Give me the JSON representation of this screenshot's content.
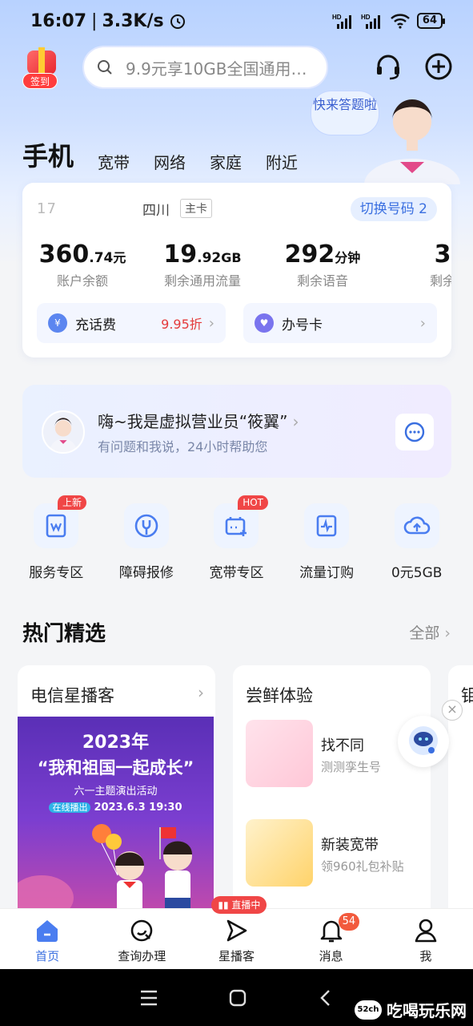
{
  "status_bar": {
    "time": "16:07",
    "speed": "3.3K/s",
    "battery": "64"
  },
  "header": {
    "signin_label": "签到",
    "search_placeholder": "9.9元享10GB全国通用…",
    "bubble_text": "快来答题啦"
  },
  "tabs": [
    "手机",
    "宽带",
    "网络",
    "家庭",
    "附近"
  ],
  "account": {
    "number": "17",
    "region": "四川",
    "card_type": "主卡",
    "switch_label": "切换号码 2",
    "stats": [
      {
        "value_int": "360",
        "value_dec": ".74",
        "unit": "元",
        "label": "账户余额"
      },
      {
        "value_int": "19",
        "value_dec": ".92",
        "unit": "GB",
        "label": "剩余通用流量"
      },
      {
        "value_int": "292",
        "value_dec": "",
        "unit": "分钟",
        "label": "剩余语音"
      },
      {
        "value_int": "3",
        "value_dec": "",
        "unit": "",
        "label": "剩余"
      }
    ],
    "recharge_label": "充话费",
    "recharge_discount": "9.95折",
    "newcard_label": "办号卡"
  },
  "assistant": {
    "title": "嗨~我是虚拟营业员“筱翼”",
    "subtitle": "有问题和我说，24小时帮助您"
  },
  "quick_actions": [
    {
      "label": "服务专区",
      "badge": "上新"
    },
    {
      "label": "障碍报修",
      "badge": ""
    },
    {
      "label": "宽带专区",
      "badge": "HOT"
    },
    {
      "label": "流量订购",
      "badge": ""
    },
    {
      "label": "0元5GB",
      "badge": ""
    }
  ],
  "featured": {
    "title": "热门精选",
    "more": "全部",
    "card1": {
      "title": "电信星播客",
      "promo_year": "2023年",
      "promo_title": "“我和祖国一起成长”",
      "promo_sub": "六一主题演出活动",
      "promo_tag": "在线播出",
      "promo_date": "2023.6.3 19:30"
    },
    "card2": {
      "title": "尝鲜体验",
      "items": [
        {
          "name": "找不同",
          "desc": "测测孪生号"
        },
        {
          "name": "新装宽带",
          "desc": "领960礼包补贴"
        }
      ]
    },
    "card3_title": "钼"
  },
  "bottom_nav": [
    {
      "label": "首页"
    },
    {
      "label": "查询办理"
    },
    {
      "label": "星播客",
      "live": "直播中"
    },
    {
      "label": "消息",
      "badge": "54"
    },
    {
      "label": "我"
    }
  ],
  "watermark": {
    "logo": "52ch",
    "text": "吃喝玩乐网"
  },
  "colors": {
    "accent": "#3a6fe0",
    "red": "#f04646"
  }
}
